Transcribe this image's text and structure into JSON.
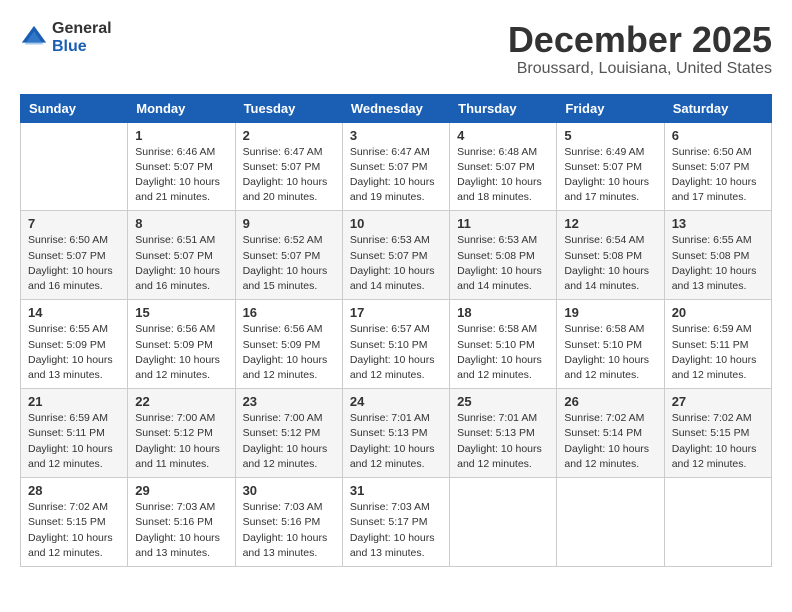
{
  "header": {
    "logo_general": "General",
    "logo_blue": "Blue",
    "month_title": "December 2025",
    "location": "Broussard, Louisiana, United States"
  },
  "calendar": {
    "headers": [
      "Sunday",
      "Monday",
      "Tuesday",
      "Wednesday",
      "Thursday",
      "Friday",
      "Saturday"
    ],
    "weeks": [
      [
        {
          "day": "",
          "info": ""
        },
        {
          "day": "1",
          "info": "Sunrise: 6:46 AM\nSunset: 5:07 PM\nDaylight: 10 hours\nand 21 minutes."
        },
        {
          "day": "2",
          "info": "Sunrise: 6:47 AM\nSunset: 5:07 PM\nDaylight: 10 hours\nand 20 minutes."
        },
        {
          "day": "3",
          "info": "Sunrise: 6:47 AM\nSunset: 5:07 PM\nDaylight: 10 hours\nand 19 minutes."
        },
        {
          "day": "4",
          "info": "Sunrise: 6:48 AM\nSunset: 5:07 PM\nDaylight: 10 hours\nand 18 minutes."
        },
        {
          "day": "5",
          "info": "Sunrise: 6:49 AM\nSunset: 5:07 PM\nDaylight: 10 hours\nand 17 minutes."
        },
        {
          "day": "6",
          "info": "Sunrise: 6:50 AM\nSunset: 5:07 PM\nDaylight: 10 hours\nand 17 minutes."
        }
      ],
      [
        {
          "day": "7",
          "info": "Sunrise: 6:50 AM\nSunset: 5:07 PM\nDaylight: 10 hours\nand 16 minutes."
        },
        {
          "day": "8",
          "info": "Sunrise: 6:51 AM\nSunset: 5:07 PM\nDaylight: 10 hours\nand 16 minutes."
        },
        {
          "day": "9",
          "info": "Sunrise: 6:52 AM\nSunset: 5:07 PM\nDaylight: 10 hours\nand 15 minutes."
        },
        {
          "day": "10",
          "info": "Sunrise: 6:53 AM\nSunset: 5:07 PM\nDaylight: 10 hours\nand 14 minutes."
        },
        {
          "day": "11",
          "info": "Sunrise: 6:53 AM\nSunset: 5:08 PM\nDaylight: 10 hours\nand 14 minutes."
        },
        {
          "day": "12",
          "info": "Sunrise: 6:54 AM\nSunset: 5:08 PM\nDaylight: 10 hours\nand 14 minutes."
        },
        {
          "day": "13",
          "info": "Sunrise: 6:55 AM\nSunset: 5:08 PM\nDaylight: 10 hours\nand 13 minutes."
        }
      ],
      [
        {
          "day": "14",
          "info": "Sunrise: 6:55 AM\nSunset: 5:09 PM\nDaylight: 10 hours\nand 13 minutes."
        },
        {
          "day": "15",
          "info": "Sunrise: 6:56 AM\nSunset: 5:09 PM\nDaylight: 10 hours\nand 12 minutes."
        },
        {
          "day": "16",
          "info": "Sunrise: 6:56 AM\nSunset: 5:09 PM\nDaylight: 10 hours\nand 12 minutes."
        },
        {
          "day": "17",
          "info": "Sunrise: 6:57 AM\nSunset: 5:10 PM\nDaylight: 10 hours\nand 12 minutes."
        },
        {
          "day": "18",
          "info": "Sunrise: 6:58 AM\nSunset: 5:10 PM\nDaylight: 10 hours\nand 12 minutes."
        },
        {
          "day": "19",
          "info": "Sunrise: 6:58 AM\nSunset: 5:10 PM\nDaylight: 10 hours\nand 12 minutes."
        },
        {
          "day": "20",
          "info": "Sunrise: 6:59 AM\nSunset: 5:11 PM\nDaylight: 10 hours\nand 12 minutes."
        }
      ],
      [
        {
          "day": "21",
          "info": "Sunrise: 6:59 AM\nSunset: 5:11 PM\nDaylight: 10 hours\nand 12 minutes."
        },
        {
          "day": "22",
          "info": "Sunrise: 7:00 AM\nSunset: 5:12 PM\nDaylight: 10 hours\nand 11 minutes."
        },
        {
          "day": "23",
          "info": "Sunrise: 7:00 AM\nSunset: 5:12 PM\nDaylight: 10 hours\nand 12 minutes."
        },
        {
          "day": "24",
          "info": "Sunrise: 7:01 AM\nSunset: 5:13 PM\nDaylight: 10 hours\nand 12 minutes."
        },
        {
          "day": "25",
          "info": "Sunrise: 7:01 AM\nSunset: 5:13 PM\nDaylight: 10 hours\nand 12 minutes."
        },
        {
          "day": "26",
          "info": "Sunrise: 7:02 AM\nSunset: 5:14 PM\nDaylight: 10 hours\nand 12 minutes."
        },
        {
          "day": "27",
          "info": "Sunrise: 7:02 AM\nSunset: 5:15 PM\nDaylight: 10 hours\nand 12 minutes."
        }
      ],
      [
        {
          "day": "28",
          "info": "Sunrise: 7:02 AM\nSunset: 5:15 PM\nDaylight: 10 hours\nand 12 minutes."
        },
        {
          "day": "29",
          "info": "Sunrise: 7:03 AM\nSunset: 5:16 PM\nDaylight: 10 hours\nand 13 minutes."
        },
        {
          "day": "30",
          "info": "Sunrise: 7:03 AM\nSunset: 5:16 PM\nDaylight: 10 hours\nand 13 minutes."
        },
        {
          "day": "31",
          "info": "Sunrise: 7:03 AM\nSunset: 5:17 PM\nDaylight: 10 hours\nand 13 minutes."
        },
        {
          "day": "",
          "info": ""
        },
        {
          "day": "",
          "info": ""
        },
        {
          "day": "",
          "info": ""
        }
      ]
    ]
  }
}
